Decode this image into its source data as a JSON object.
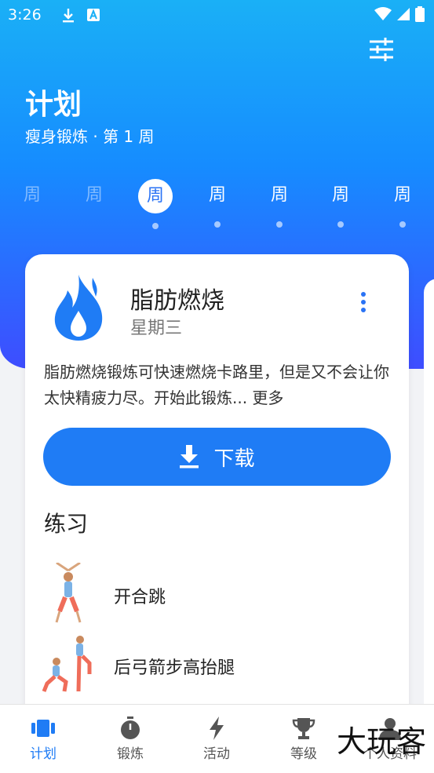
{
  "status": {
    "time": "3:26"
  },
  "header": {
    "title": "计划",
    "subtitle": "瘦身锻炼 · 第 1 周"
  },
  "weeks": [
    "周",
    "周",
    "周",
    "周",
    "周",
    "周",
    "周"
  ],
  "workout": {
    "title": "脂肪燃烧",
    "day": "星期三",
    "description": "脂肪燃烧锻炼可快速燃烧卡路里，但是又不会让你太快精疲力尽。开始此锻炼... 更多",
    "download_label": "下载"
  },
  "exercises": {
    "heading": "练习",
    "items": [
      {
        "name": "开合跳"
      },
      {
        "name": "后弓箭步高抬腿"
      }
    ]
  },
  "nav": {
    "items": [
      {
        "label": "计划",
        "icon": "plan-icon"
      },
      {
        "label": "锻炼",
        "icon": "stopwatch-icon"
      },
      {
        "label": "活动",
        "icon": "lightning-icon"
      },
      {
        "label": "等级",
        "icon": "trophy-icon"
      },
      {
        "label": "个人资料",
        "icon": "profile-icon"
      }
    ]
  },
  "watermark": "大玩客",
  "colors": {
    "accent": "#1f7cf5",
    "header_top": "#1ab0f6",
    "header_bottom": "#3e4dff"
  }
}
